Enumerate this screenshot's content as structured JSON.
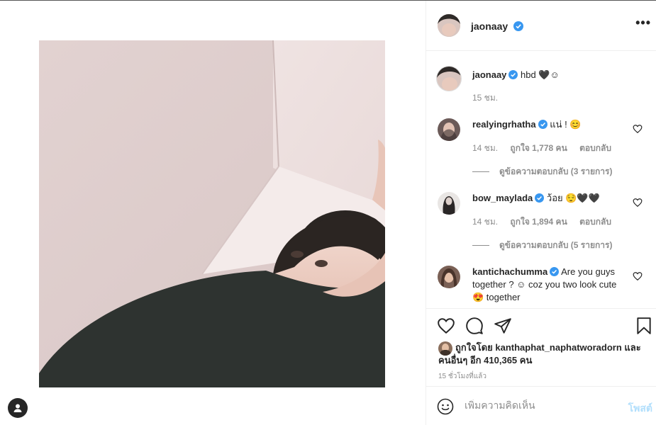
{
  "post": {
    "author": "jaonaay",
    "more_label": "•••"
  },
  "caption": {
    "username": "jaonaay",
    "text": "hbd 🖤☺",
    "time": "15 ชม."
  },
  "comments": [
    {
      "username": "realyingrhatha",
      "text": "แน่ ! 😊",
      "time": "14 ชม.",
      "likes": "ถูกใจ 1,778 คน",
      "reply_label": "ตอบกลับ",
      "view_replies": "ดูข้อความตอบกลับ (3 รายการ)"
    },
    {
      "username": "bow_maylada",
      "text": "ว้อย 😌🖤🖤",
      "time": "14 ชม.",
      "likes": "ถูกใจ 1,894 คน",
      "reply_label": "ตอบกลับ",
      "view_replies": "ดูข้อความตอบกลับ (5 รายการ)"
    },
    {
      "username": "kantichachumma",
      "text": "Are you guys together ? ☺ coz you two look cute 😍 together"
    }
  ],
  "liked": {
    "text": "ถูกใจโดย kanthaphat_naphatworadorn และคนอื่นๆ อีก 410,365 คน"
  },
  "timeago": "15 ชั่วโมงที่แล้ว",
  "add_comment": {
    "placeholder": "เพิ่มความคิดเห็น",
    "post_label": "โพสต์"
  },
  "icons": {
    "like": "heart-icon",
    "comment": "comment-bubble-icon",
    "share": "paper-plane-icon",
    "save": "bookmark-icon",
    "emoji": "smiley-icon",
    "verified": "verified-badge-icon",
    "profile": "user-icon"
  },
  "colors": {
    "verified": "#3897f0",
    "post_button_disabled": "#b2dffc",
    "secondary_text": "#8e8e8e"
  }
}
